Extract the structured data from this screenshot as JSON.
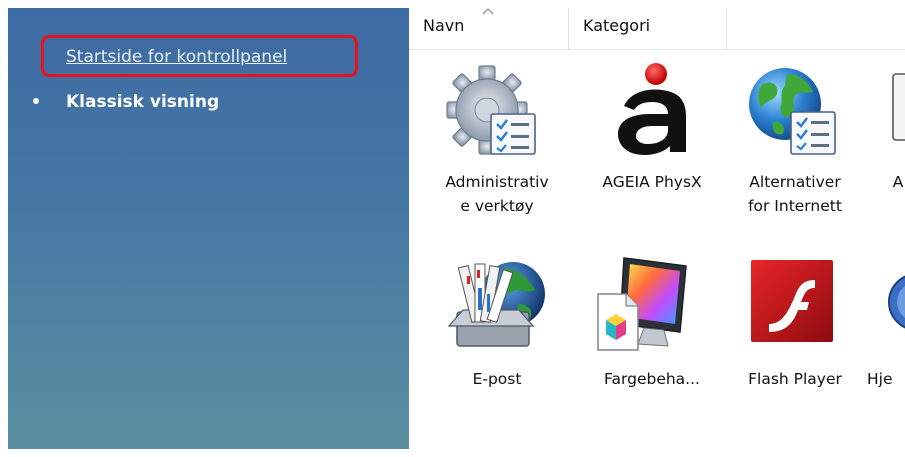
{
  "left_pane": {
    "home_link": "Startside for kontrollpanel",
    "classic_view": "Klassisk visning"
  },
  "columns": {
    "name": "Navn",
    "category": "Kategori"
  },
  "items": [
    {
      "label": "Administrativ\ne verktøy",
      "icon": "admin-tools-icon"
    },
    {
      "label": "AGEIA PhysX",
      "icon": "ageia-physx-icon"
    },
    {
      "label": "Alternativer\nfor Internett",
      "icon": "internet-options-icon"
    },
    {
      "label": "A",
      "icon": "partial-icon"
    },
    {
      "label": "E-post",
      "icon": "email-icon"
    },
    {
      "label": "Fargebeha...",
      "icon": "color-management-icon"
    },
    {
      "label": "Flash Player",
      "icon": "flash-player-icon"
    },
    {
      "label": "Hje",
      "icon": "help-icon"
    }
  ],
  "colors": {
    "pane_top": "#3d6aa3",
    "pane_bottom": "#5a8fa0",
    "highlight": "#e8121b",
    "flash_red": "#c8141c"
  }
}
